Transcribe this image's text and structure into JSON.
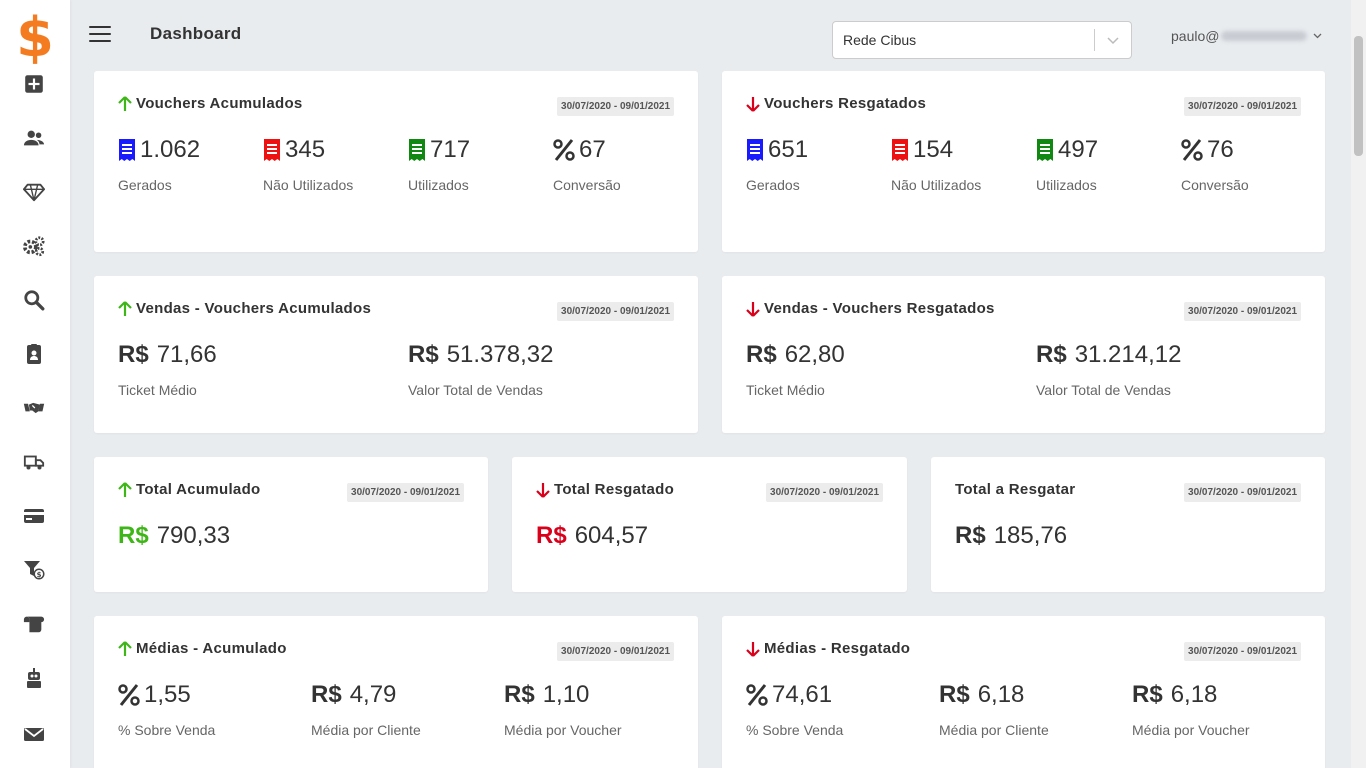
{
  "header": {
    "title": "Dashboard",
    "store_select": "Rede Cibus",
    "user_prefix": "paulo@"
  },
  "sidebar": {
    "icons": [
      "plus-square-icon",
      "users-icon",
      "diamond-icon",
      "cogs-icon",
      "search-icon",
      "id-badge-icon",
      "handshake-icon",
      "truck-icon",
      "credit-card-icon",
      "filter-dollar-icon",
      "scroll-icon",
      "robot-icon",
      "envelope-icon"
    ]
  },
  "colors": {
    "up": "#3fb618",
    "down": "#d9001b",
    "blue": "#1a1aff",
    "red": "#ee1111",
    "green": "#118811",
    "accent": "#f47b20"
  },
  "vouchers_acumulados": {
    "title": "Vouchers Acumulados",
    "date": "30/07/2020 - 09/01/2021",
    "stats": [
      {
        "value": "1.062",
        "label": "Gerados"
      },
      {
        "value": "345",
        "label": "Não Utilizados"
      },
      {
        "value": "717",
        "label": "Utilizados"
      },
      {
        "value": "67",
        "label": "Conversão"
      }
    ]
  },
  "vouchers_resgatados": {
    "title": "Vouchers Resgatados",
    "date": "30/07/2020 - 09/01/2021",
    "stats": [
      {
        "value": "651",
        "label": "Gerados"
      },
      {
        "value": "154",
        "label": "Não Utilizados"
      },
      {
        "value": "497",
        "label": "Utilizados"
      },
      {
        "value": "76",
        "label": "Conversão"
      }
    ]
  },
  "vendas_acumulados": {
    "title": "Vendas - Vouchers Acumulados",
    "date": "30/07/2020 - 09/01/2021",
    "currency": "R$",
    "stats": [
      {
        "value": "71,66",
        "label": "Ticket Médio"
      },
      {
        "value": "51.378,32",
        "label": "Valor Total de Vendas"
      }
    ]
  },
  "vendas_resgatados": {
    "title": "Vendas - Vouchers Resgatados",
    "date": "30/07/2020 - 09/01/2021",
    "currency": "R$",
    "stats": [
      {
        "value": "62,80",
        "label": "Ticket Médio"
      },
      {
        "value": "31.214,12",
        "label": "Valor Total de Vendas"
      }
    ]
  },
  "total_acumulado": {
    "title": "Total Acumulado",
    "date": "30/07/2020 - 09/01/2021",
    "currency": "R$",
    "value": "790,33"
  },
  "total_resgatado": {
    "title": "Total Resgatado",
    "date": "30/07/2020 - 09/01/2021",
    "currency": "R$",
    "value": "604,57"
  },
  "total_a_resgatar": {
    "title": "Total a Resgatar",
    "date": "30/07/2020 - 09/01/2021",
    "currency": "R$",
    "value": "185,76"
  },
  "medias_acumulado": {
    "title": "Médias - Acumulado",
    "date": "30/07/2020 - 09/01/2021",
    "currency": "R$",
    "stats": [
      {
        "value": "1,55",
        "label": "% Sobre Venda"
      },
      {
        "value": "4,79",
        "label": "Média por Cliente"
      },
      {
        "value": "1,10",
        "label": "Média por Voucher"
      }
    ]
  },
  "medias_resgatado": {
    "title": "Médias - Resgatado",
    "date": "30/07/2020 - 09/01/2021",
    "currency": "R$",
    "stats": [
      {
        "value": "74,61",
        "label": "% Sobre Venda"
      },
      {
        "value": "6,18",
        "label": "Média por Cliente"
      },
      {
        "value": "6,18",
        "label": "Média por Voucher"
      }
    ]
  }
}
